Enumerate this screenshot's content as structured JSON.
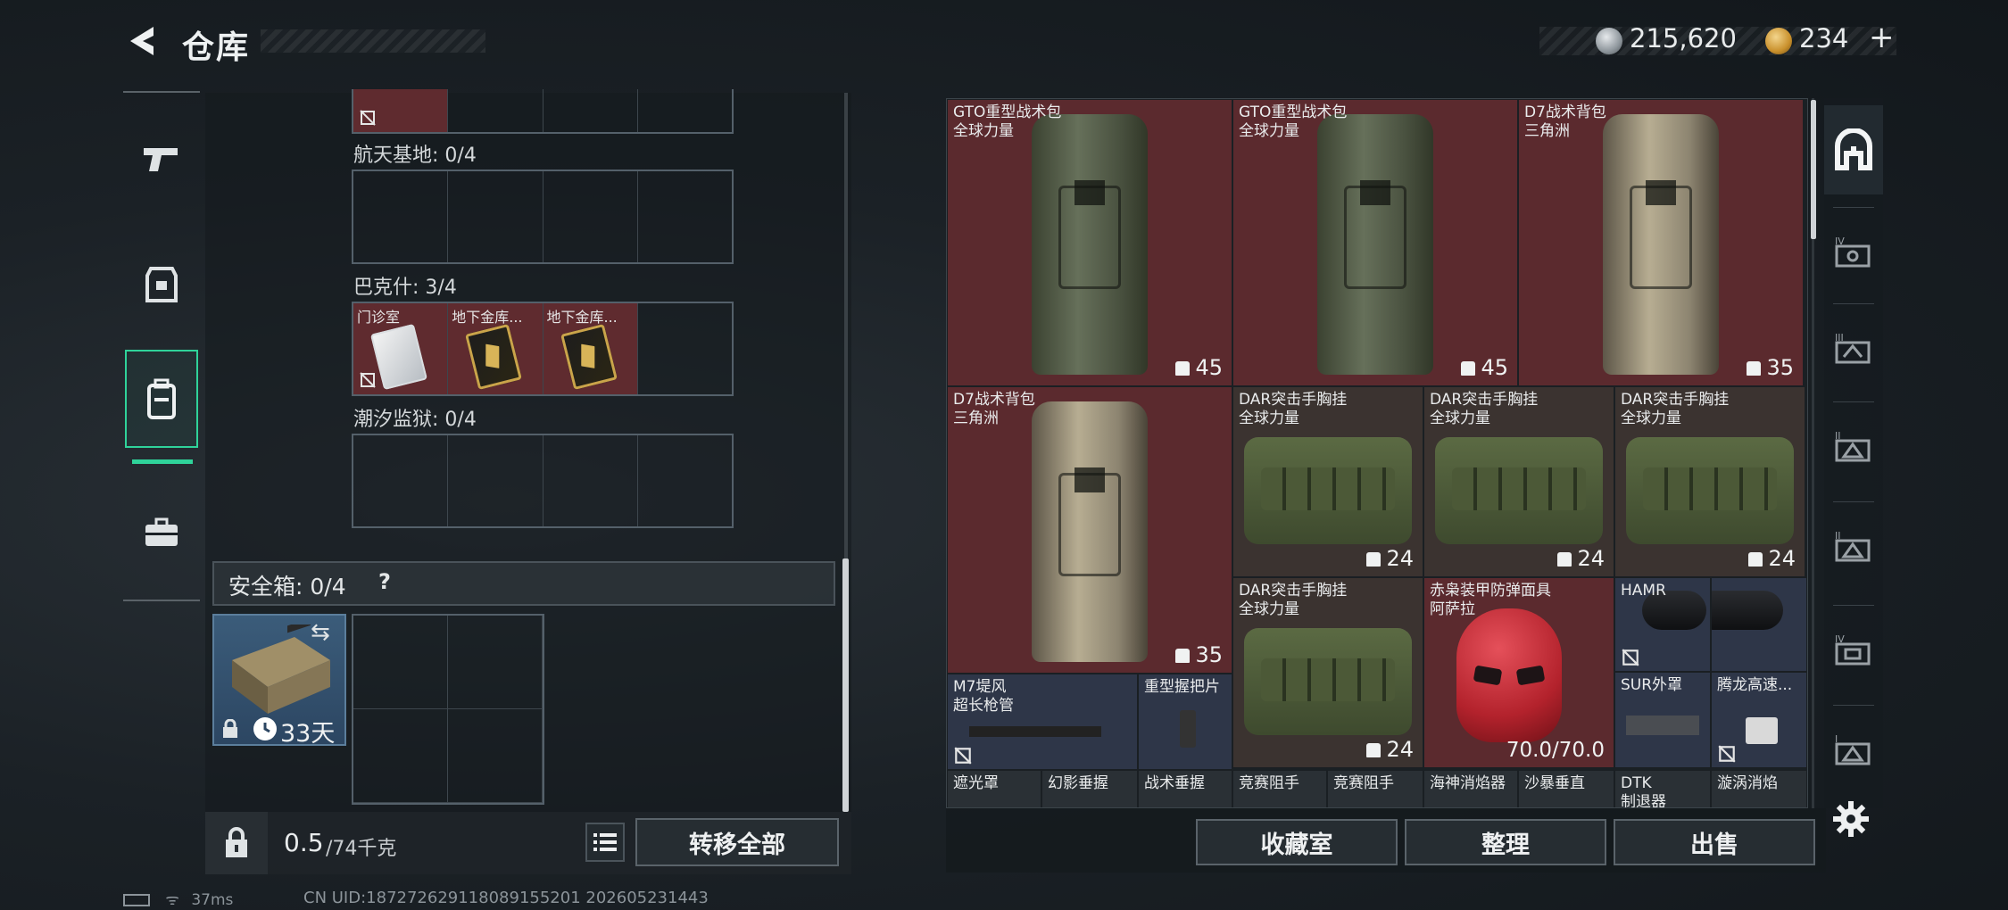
{
  "header": {
    "title": "仓库",
    "silver_amount": "215,620",
    "gold_amount": "234",
    "gold_plus": "+"
  },
  "colors": {
    "accent": "#2fd39a",
    "item_red": "#5b2a2e",
    "item_brown": "#3b3330",
    "item_blue": "#2e3648"
  },
  "sidenav": [
    {
      "icon": "pistol-icon",
      "active": false
    },
    {
      "icon": "armor-icon",
      "active": false
    },
    {
      "icon": "backpack-icon",
      "active": true
    },
    {
      "icon": "briefcase-icon",
      "active": false
    }
  ],
  "left_panel": {
    "sections": [
      {
        "label": "航天基地: 0/4"
      },
      {
        "label": "巴克什: 3/4",
        "cards": [
          "门诊室",
          "地下金库...",
          "地下金库..."
        ]
      },
      {
        "label": "潮汐监狱: 0/4"
      }
    ],
    "safe_box": {
      "label": "安全箱: 0/4",
      "help": "?",
      "days": "33天"
    },
    "footer": {
      "weight_current": "0.5",
      "weight_max": "/74千克",
      "transfer_all_label": "转移全部"
    }
  },
  "right_panel": {
    "items": [
      {
        "name": "GTO重型战术包\n全球力量",
        "count": "45",
        "icon": "capacity-icon"
      },
      {
        "name": "GTO重型战术包\n全球力量",
        "count": "45",
        "icon": "capacity-icon"
      },
      {
        "name": "D7战术背包\n三角洲",
        "count": "35",
        "icon": "capacity-icon"
      },
      {
        "name": "D7战术背包\n三角洲",
        "count": "35",
        "icon": "capacity-icon"
      },
      {
        "name": "DAR突击手胸挂\n全球力量",
        "count": "24",
        "icon": "vest-capacity-icon"
      },
      {
        "name": "DAR突击手胸挂\n全球力量",
        "count": "24",
        "icon": "vest-capacity-icon"
      },
      {
        "name": "DAR突击手胸挂\n全球力量",
        "count": "24",
        "icon": "vest-capacity-icon"
      },
      {
        "name": "DAR突击手胸挂\n全球力量",
        "count": "24",
        "icon": "vest-capacity-icon"
      },
      {
        "name": "赤枭装甲防弹面具\n阿萨拉",
        "durability": "70.0/70.0"
      },
      {
        "name": "HAMR"
      },
      {
        "name": "M7堤风\n超长枪管"
      },
      {
        "name": "重型握把片"
      },
      {
        "name": "SUR外罩"
      },
      {
        "name": "腾龙高速..."
      },
      {
        "name": "遮光罩"
      },
      {
        "name": "幻影垂握"
      },
      {
        "name": "战术垂握"
      },
      {
        "name": "竞赛阻手"
      },
      {
        "name": "竞赛阻手"
      },
      {
        "name": "海神消焰器"
      },
      {
        "name": "沙暴垂直"
      },
      {
        "name": "DTK\n制退器"
      },
      {
        "name": "漩涡消焰"
      }
    ],
    "footer": {
      "collection_label": "收藏室",
      "sort_label": "整理",
      "sell_label": "出售"
    }
  },
  "status": {
    "ping": "37ms",
    "uid": "CN UID:187272629118089155201 202605231443"
  }
}
